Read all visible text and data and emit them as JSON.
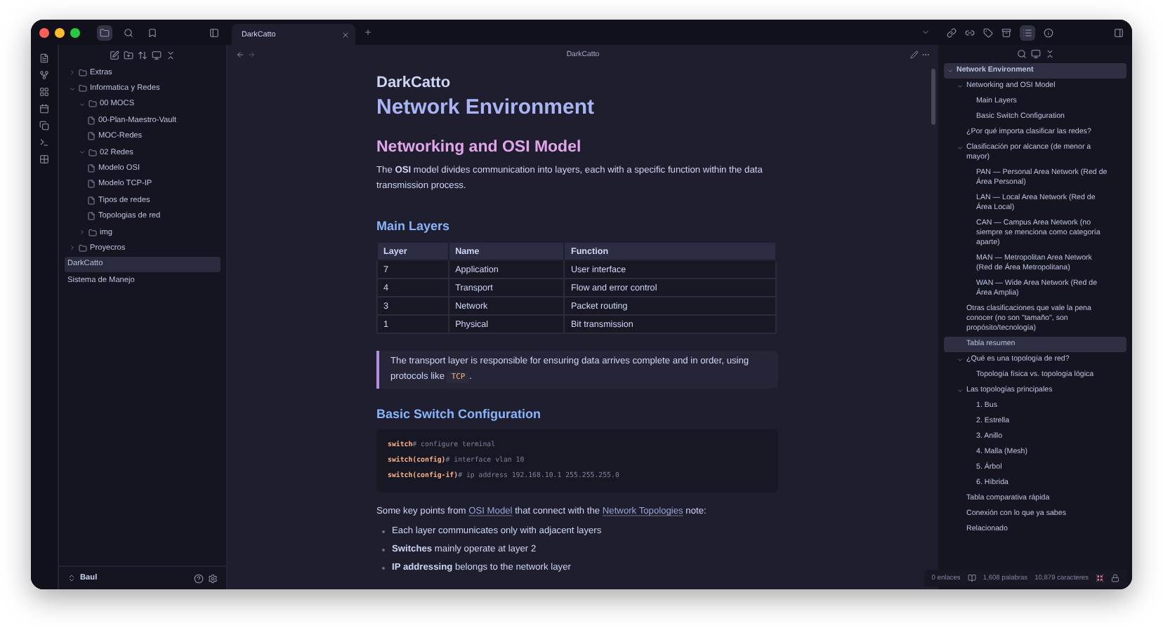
{
  "tab": {
    "label": "DarkCatto"
  },
  "file_tree": [
    {
      "label": "Extras",
      "kind": "folder",
      "expanded": false,
      "selected": false
    },
    {
      "label": "Informatica y Redes",
      "kind": "folder",
      "expanded": true,
      "selected": false,
      "children": [
        {
          "label": "00 MOCS",
          "kind": "folder",
          "expanded": true,
          "selected": false,
          "children": [
            {
              "label": "00-Plan-Maestro-Vault",
              "kind": "note",
              "selected": false
            },
            {
              "label": "MOC-Redes",
              "kind": "note",
              "selected": false
            }
          ]
        },
        {
          "label": "02 Redes",
          "kind": "folder",
          "expanded": true,
          "selected": false,
          "children": [
            {
              "label": "Modelo OSI",
              "kind": "note",
              "selected": false
            },
            {
              "label": "Modelo TCP-IP",
              "kind": "note",
              "selected": false
            },
            {
              "label": "Tipos de redes",
              "kind": "note",
              "selected": false
            },
            {
              "label": "Topologias de red",
              "kind": "note",
              "selected": false
            }
          ]
        },
        {
          "label": "img",
          "kind": "folder",
          "expanded": false,
          "selected": false
        }
      ]
    },
    {
      "label": "Proyecros",
      "kind": "folder",
      "expanded": false,
      "selected": false
    },
    {
      "label": "DarkCatto",
      "kind": "page",
      "selected": true
    },
    {
      "label": "Sistema de Manejo",
      "kind": "page",
      "selected": false
    }
  ],
  "vault": {
    "name": "Baul"
  },
  "note": {
    "header": "DarkCatto",
    "title": "DarkCatto",
    "blocks": [
      {
        "kind": "h1",
        "text": "Network Environment"
      },
      {
        "kind": "h2",
        "text": "Networking and OSI Model"
      },
      {
        "kind": "paragraph",
        "text": "The **OSI** model divides communication into layers, each with a specific function within the data transmission process."
      },
      {
        "kind": "h3",
        "text": "Main Layers"
      },
      {
        "kind": "table",
        "columns": [
          "Layer",
          "Name",
          "Function"
        ],
        "rows": [
          [
            "7",
            "Application",
            "User interface"
          ],
          [
            "4",
            "Transport",
            "Flow and error control"
          ],
          [
            "3",
            "Network",
            "Packet routing"
          ],
          [
            "1",
            "Physical",
            "Bit transmission"
          ]
        ]
      },
      {
        "kind": "callout",
        "segments": [
          {
            "kind": "text",
            "text": "The transport layer is responsible for ensuring data arrives complete and in order, using protocols like "
          },
          {
            "kind": "code",
            "text": "TCP"
          },
          {
            "kind": "text",
            "text": "."
          }
        ]
      },
      {
        "kind": "h3",
        "text": "Basic Switch Configuration"
      },
      {
        "kind": "code",
        "lines": [
          {
            "prompt": "switch",
            "command": "# configure terminal"
          },
          {
            "prompt": "switch(config)",
            "command": "# interface vlan 10"
          },
          {
            "prompt": "switch(config-if)",
            "command": "# ip address 192.168.10.1 255.255.255.0"
          }
        ]
      },
      {
        "kind": "linked_paragraph",
        "segments": [
          {
            "kind": "text",
            "text": "Some key points from "
          },
          {
            "kind": "link",
            "text": "OSI Model"
          },
          {
            "kind": "text",
            "text": " that connect with the "
          },
          {
            "kind": "link",
            "text": "Network Topologies"
          },
          {
            "kind": "text",
            "text": " note:"
          }
        ]
      },
      {
        "kind": "list",
        "items": [
          "Each layer communicates only with adjacent layers",
          "**Switches** mainly operate at layer 2",
          "**IP addressing** belongs to the network layer"
        ]
      }
    ]
  },
  "outline": [
    {
      "label": "Network Environment",
      "expanded": true,
      "selected": true,
      "children": [
        {
          "label": "Networking and OSI Model",
          "expanded": true,
          "selected": false,
          "children": [
            {
              "label": "Main Layers",
              "selected": false
            },
            {
              "label": "Basic Switch Configuration",
              "selected": false
            }
          ]
        },
        {
          "label": "¿Por qué importa clasificar las redes?",
          "selected": false
        },
        {
          "label": "Clasificación por alcance (de menor a mayor)",
          "expanded": true,
          "selected": false,
          "children": [
            {
              "label": "PAN — Personal Area Network (Red de Área Personal)",
              "selected": false
            },
            {
              "label": "LAN — Local Area Network (Red de Área Local)",
              "selected": false
            },
            {
              "label": "CAN — Campus Area Network (no siempre se menciona como categoría aparte)",
              "selected": false
            },
            {
              "label": "MAN — Metropolitan Area Network (Red de Área Metropolitana)",
              "selected": false
            },
            {
              "label": "WAN — Wide Area Network (Red de Área Amplia)",
              "selected": false
            }
          ]
        },
        {
          "label": "Otras clasificaciones que vale la pena conocer (no son \"tamaño\", son propósito/tecnología)",
          "selected": false
        },
        {
          "label": "Tabla resumen",
          "selected": true
        },
        {
          "label": "¿Qué es una topología de red?",
          "expanded": true,
          "selected": false,
          "children": [
            {
              "label": "Topología física vs. topología lógica",
              "selected": false
            }
          ]
        },
        {
          "label": "Las topologías principales",
          "expanded": true,
          "selected": false,
          "children": [
            {
              "label": "1. Bus",
              "selected": false
            },
            {
              "label": "2. Estrella",
              "selected": false
            },
            {
              "label": "3. Anillo",
              "selected": false
            },
            {
              "label": "4. Malla (Mesh)",
              "selected": false
            },
            {
              "label": "5. Árbol",
              "selected": false
            },
            {
              "label": "6. Híbrida",
              "selected": false
            }
          ]
        },
        {
          "label": "Tabla comparativa rápida",
          "selected": false
        },
        {
          "label": "Conexión con lo que ya sabes",
          "selected": false
        },
        {
          "label": "Relacionado",
          "selected": false
        }
      ]
    }
  ],
  "status_bar": {
    "backlinks": "0 enlaces",
    "words": "1,608 palabras",
    "characters": "10,879 caracteres"
  }
}
